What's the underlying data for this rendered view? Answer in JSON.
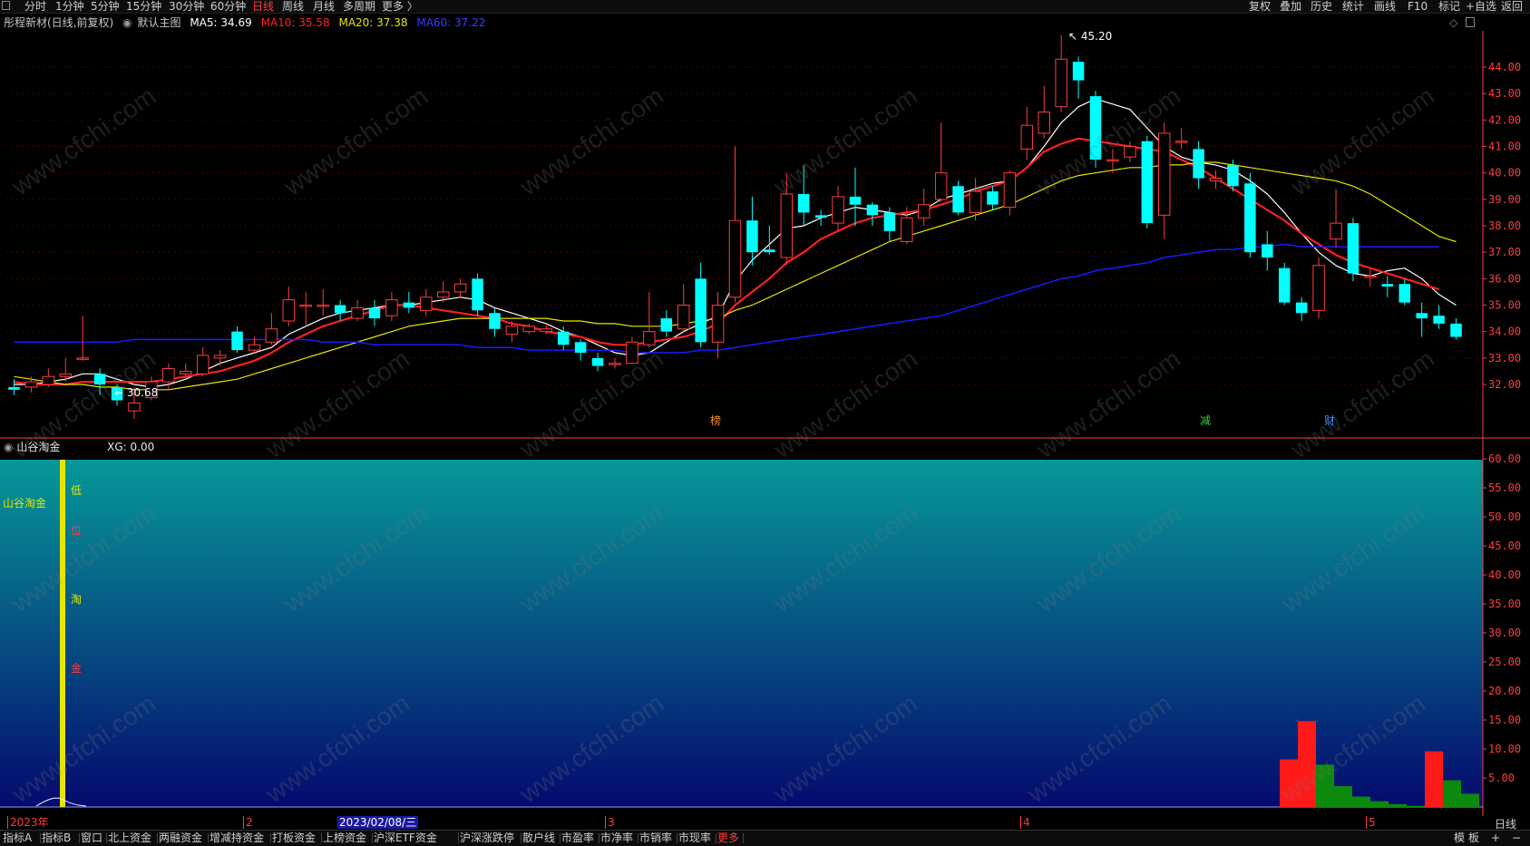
{
  "toolbar": {
    "left_items": [
      "分时",
      "1分钟",
      "5分钟",
      "15分钟",
      "30分钟",
      "60分钟",
      "日线",
      "周线",
      "月线",
      "多周期",
      "更多 〉"
    ],
    "active_item": "日线",
    "right_items": [
      "复权",
      "叠加",
      "历史",
      "统计",
      "画线",
      "F10",
      "标记",
      "+自选",
      "返回"
    ]
  },
  "main_header": {
    "stock_name": "彤程新材(日线,前复权)",
    "indicator_name": "默认主图",
    "ma5": "MA5: 34.69",
    "ma10": "MA10: 35.58",
    "ma20": "MA20: 37.38",
    "ma60": "MA60: 37.22"
  },
  "colors": {
    "ma5": "#ffffff",
    "ma10": "#ff2020",
    "ma20": "#e6e600",
    "ma60": "#1a1aff",
    "up": "#ff3c3c",
    "down": "#00ffff",
    "axis": "#ff3c3c",
    "sub_top": "#069898",
    "sub_bottom": "#050a6e"
  },
  "annotations": {
    "high": "45.20",
    "low": "30.68",
    "events": [
      "榜",
      "减",
      "财"
    ]
  },
  "price_axis": [
    "44.00",
    "43.00",
    "42.00",
    "41.00",
    "40.00",
    "39.00",
    "38.00",
    "37.00",
    "36.00",
    "35.00",
    "34.00",
    "33.00",
    "32.00"
  ],
  "sub_header": {
    "title": "山谷淘金",
    "value": "XG: 0.00"
  },
  "sub_chart": {
    "label": "山谷淘金",
    "vertical_text": [
      "低",
      "位",
      "淘",
      "金"
    ],
    "axis": [
      "60.00",
      "55.00",
      "50.00",
      "45.00",
      "40.00",
      "35.00",
      "30.00",
      "25.00",
      "20.00",
      "15.00",
      "10.00",
      "5.00"
    ],
    "bars": [
      {
        "color": "red",
        "value": 8.2
      },
      {
        "color": "red",
        "value": 14.8
      },
      {
        "color": "green",
        "value": 7.3
      },
      {
        "color": "green",
        "value": 3.6
      },
      {
        "color": "green",
        "value": 1.8
      },
      {
        "color": "green",
        "value": 1.0
      },
      {
        "color": "green",
        "value": 0.5
      },
      {
        "color": "green",
        "value": 0.2
      },
      {
        "color": "red",
        "value": 9.6
      },
      {
        "color": "green",
        "value": 4.6
      },
      {
        "color": "green",
        "value": 2.3
      }
    ]
  },
  "date_axis": {
    "labels": [
      "2023年",
      "2",
      "3",
      "4",
      "5"
    ],
    "cursor_date": "2023/02/08/三"
  },
  "bottom_bar": {
    "items": [
      "指标A",
      "指标B",
      "窗口",
      "北上资金",
      "两融资金",
      "增减持资金",
      "打板资金",
      "上榜资金",
      "沪深ETF资金",
      "沪深涨跌停",
      "散户线",
      "市盈率",
      "市净率",
      "市销率",
      "市现率",
      "更多"
    ],
    "right_items": [
      "模",
      "板",
      "+",
      "−"
    ],
    "period": "日线"
  },
  "watermark": "www.cfchi.com",
  "chart_data": {
    "type": "candlestick",
    "title": "彤程新材(日线,前复权)",
    "ylim": [
      31.0,
      45.5
    ],
    "candles": [
      [
        31.9,
        31.8,
        32.2,
        31.6
      ],
      [
        31.9,
        32.1,
        32.3,
        31.7
      ],
      [
        32.0,
        32.3,
        32.6,
        31.9
      ],
      [
        32.3,
        32.4,
        33.0,
        32.1
      ],
      [
        33.0,
        33.0,
        34.6,
        32.9
      ],
      [
        32.4,
        32.0,
        32.6,
        31.6
      ],
      [
        31.9,
        31.4,
        32.0,
        31.2
      ],
      [
        31.0,
        31.3,
        31.9,
        30.7
      ],
      [
        31.5,
        32.1,
        32.3,
        31.4
      ],
      [
        32.1,
        32.6,
        32.8,
        31.8
      ],
      [
        32.4,
        32.5,
        32.8,
        32.2
      ],
      [
        32.4,
        33.1,
        33.4,
        32.3
      ],
      [
        33.0,
        33.1,
        33.3,
        32.7
      ],
      [
        34.0,
        33.3,
        34.2,
        33.2
      ],
      [
        33.3,
        33.5,
        33.8,
        33.2
      ],
      [
        33.6,
        34.1,
        34.7,
        33.5
      ],
      [
        34.4,
        35.2,
        35.7,
        34.2
      ],
      [
        35.0,
        35.0,
        35.5,
        34.2
      ],
      [
        35.0,
        35.0,
        35.6,
        34.6
      ],
      [
        35.0,
        34.7,
        35.2,
        34.4
      ],
      [
        34.5,
        34.9,
        35.2,
        34.4
      ],
      [
        34.9,
        34.5,
        35.2,
        34.2
      ],
      [
        34.6,
        35.2,
        35.5,
        34.4
      ],
      [
        35.1,
        34.9,
        35.5,
        34.7
      ],
      [
        34.8,
        35.3,
        35.6,
        34.6
      ],
      [
        35.3,
        35.5,
        35.9,
        35.1
      ],
      [
        35.5,
        35.8,
        36.0,
        35.3
      ],
      [
        36.0,
        34.8,
        36.2,
        34.6
      ],
      [
        34.7,
        34.1,
        34.9,
        33.8
      ],
      [
        33.9,
        34.2,
        34.4,
        33.6
      ],
      [
        34.0,
        34.2,
        34.3,
        33.9
      ],
      [
        34.0,
        34.1,
        34.3,
        33.9
      ],
      [
        34.0,
        33.5,
        34.2,
        33.3
      ],
      [
        33.6,
        33.2,
        33.7,
        32.9
      ],
      [
        33.0,
        32.7,
        33.2,
        32.5
      ],
      [
        32.8,
        32.8,
        33.0,
        32.6
      ],
      [
        32.8,
        33.6,
        33.8,
        32.8
      ],
      [
        33.5,
        34.0,
        35.5,
        33.4
      ],
      [
        34.5,
        34.0,
        34.8,
        33.8
      ],
      [
        34.1,
        35.0,
        35.8,
        34.0
      ],
      [
        36.0,
        33.6,
        36.6,
        33.4
      ],
      [
        33.6,
        35.0,
        35.5,
        33.0
      ],
      [
        35.3,
        38.2,
        41.0,
        35.1
      ],
      [
        38.2,
        37.0,
        39.1,
        36.5
      ],
      [
        37.1,
        37.0,
        38.0,
        36.9
      ],
      [
        36.8,
        39.2,
        40.0,
        36.5
      ],
      [
        39.2,
        38.5,
        40.3,
        38.0
      ],
      [
        38.4,
        38.3,
        38.6,
        38.0
      ],
      [
        38.1,
        39.1,
        39.5,
        37.8
      ],
      [
        39.1,
        38.8,
        40.2,
        38.0
      ],
      [
        38.8,
        38.4,
        38.9,
        38.0
      ],
      [
        38.5,
        37.8,
        38.7,
        37.4
      ],
      [
        37.4,
        38.3,
        38.7,
        37.3
      ],
      [
        38.3,
        38.8,
        39.4,
        38.0
      ],
      [
        39.0,
        40.0,
        41.9,
        38.9
      ],
      [
        39.5,
        38.5,
        39.7,
        38.4
      ],
      [
        38.5,
        39.3,
        39.8,
        38.2
      ],
      [
        39.3,
        38.8,
        39.5,
        38.6
      ],
      [
        38.7,
        40.0,
        40.1,
        38.4
      ],
      [
        40.9,
        41.8,
        42.5,
        40.5
      ],
      [
        41.5,
        42.3,
        43.3,
        41.3
      ],
      [
        42.5,
        44.3,
        45.2,
        42.3
      ],
      [
        44.2,
        43.5,
        44.4,
        42.8
      ],
      [
        42.9,
        40.5,
        43.1,
        40.2
      ],
      [
        40.5,
        40.5,
        40.9,
        40.0
      ],
      [
        40.6,
        41.0,
        41.2,
        40.4
      ],
      [
        41.2,
        38.1,
        41.4,
        37.9
      ],
      [
        38.4,
        41.5,
        41.9,
        37.5
      ],
      [
        41.2,
        41.2,
        41.7,
        40.9
      ],
      [
        40.9,
        39.8,
        41.2,
        39.4
      ],
      [
        39.7,
        39.8,
        40.1,
        39.4
      ],
      [
        40.3,
        39.5,
        40.5,
        39.3
      ],
      [
        39.6,
        37.0,
        40.0,
        36.8
      ],
      [
        37.3,
        36.8,
        37.8,
        36.3
      ],
      [
        36.4,
        35.1,
        36.6,
        35.0
      ],
      [
        35.1,
        34.7,
        35.3,
        34.4
      ],
      [
        34.8,
        36.5,
        36.8,
        34.5
      ],
      [
        37.5,
        38.1,
        39.4,
        37.2
      ],
      [
        38.1,
        36.2,
        38.3,
        35.9
      ],
      [
        36.1,
        36.1,
        36.4,
        35.7
      ],
      [
        35.8,
        35.7,
        36.1,
        35.3
      ],
      [
        35.8,
        35.1,
        36.0,
        35.0
      ],
      [
        34.7,
        34.5,
        35.1,
        33.8
      ],
      [
        34.6,
        34.3,
        35.0,
        34.1
      ],
      [
        34.3,
        33.8,
        34.5,
        33.7
      ]
    ],
    "series": [
      {
        "name": "MA5",
        "values": [
          32.0,
          32.0,
          32.1,
          32.2,
          32.4,
          32.4,
          32.2,
          32.0,
          31.9,
          32.0,
          32.2,
          32.5,
          32.8,
          33.0,
          33.2,
          33.4,
          33.9,
          34.2,
          34.5,
          34.7,
          34.8,
          34.9,
          35.0,
          35.0,
          35.1,
          35.2,
          35.3,
          35.2,
          34.9,
          34.7,
          34.5,
          34.3,
          34.0,
          33.8,
          33.5,
          33.2,
          33.1,
          33.2,
          33.6,
          34.0,
          34.3,
          34.6,
          35.9,
          36.7,
          37.3,
          37.9,
          38.0,
          38.3,
          38.5,
          38.7,
          38.6,
          38.5,
          38.4,
          38.6,
          39.0,
          39.2,
          39.4,
          39.6,
          39.7,
          40.2,
          41.0,
          41.9,
          42.5,
          42.8,
          42.6,
          42.4,
          41.7,
          41.0,
          40.6,
          40.4,
          40.3,
          40.1,
          39.7,
          39.2,
          38.5,
          37.7,
          37.0,
          36.5,
          36.2,
          36.1,
          36.3,
          36.4,
          36.0,
          35.4,
          35.0
        ]
      },
      {
        "name": "MA10",
        "values": [
          32.1,
          32.0,
          32.0,
          32.0,
          32.1,
          32.1,
          32.1,
          32.1,
          32.1,
          32.2,
          32.3,
          32.4,
          32.5,
          32.7,
          32.9,
          33.2,
          33.6,
          33.9,
          34.2,
          34.4,
          34.6,
          34.8,
          35.0,
          35.0,
          34.9,
          34.8,
          34.7,
          34.6,
          34.5,
          34.3,
          34.2,
          34.0,
          33.9,
          33.8,
          33.6,
          33.5,
          33.5,
          33.6,
          33.7,
          33.8,
          34.0,
          34.3,
          35.0,
          35.5,
          36.0,
          36.6,
          37.0,
          37.5,
          37.8,
          38.1,
          38.3,
          38.4,
          38.5,
          38.6,
          38.8,
          39.0,
          39.3,
          39.5,
          39.7,
          40.2,
          40.8,
          41.1,
          41.3,
          41.2,
          41.1,
          41.0,
          40.9,
          40.8,
          40.5,
          40.2,
          39.8,
          39.4,
          39.0,
          38.6,
          38.2,
          37.7,
          37.3,
          36.9,
          36.6,
          36.4,
          36.2,
          36.0,
          35.8,
          35.6
        ]
      },
      {
        "name": "MA20",
        "values": [
          32.3,
          32.2,
          32.1,
          32.0,
          32.0,
          31.9,
          31.9,
          31.8,
          31.8,
          31.8,
          31.9,
          32.0,
          32.1,
          32.2,
          32.4,
          32.6,
          32.8,
          33.0,
          33.2,
          33.4,
          33.6,
          33.8,
          34.0,
          34.2,
          34.3,
          34.4,
          34.5,
          34.5,
          34.5,
          34.5,
          34.5,
          34.5,
          34.4,
          34.4,
          34.3,
          34.3,
          34.2,
          34.2,
          34.2,
          34.3,
          34.4,
          34.5,
          34.8,
          35.0,
          35.3,
          35.6,
          35.9,
          36.2,
          36.5,
          36.8,
          37.1,
          37.4,
          37.6,
          37.8,
          38.0,
          38.2,
          38.4,
          38.6,
          38.8,
          39.1,
          39.4,
          39.7,
          39.9,
          40.0,
          40.1,
          40.2,
          40.2,
          40.3,
          40.3,
          40.4,
          40.4,
          40.3,
          40.2,
          40.1,
          40.0,
          39.9,
          39.8,
          39.7,
          39.5,
          39.2,
          38.8,
          38.4,
          38.0,
          37.6,
          37.4
        ]
      },
      {
        "name": "MA60",
        "values": [
          33.6,
          33.6,
          33.6,
          33.6,
          33.6,
          33.6,
          33.6,
          33.7,
          33.7,
          33.7,
          33.7,
          33.7,
          33.7,
          33.7,
          33.7,
          33.7,
          33.7,
          33.7,
          33.6,
          33.6,
          33.6,
          33.5,
          33.5,
          33.5,
          33.5,
          33.5,
          33.5,
          33.4,
          33.4,
          33.4,
          33.3,
          33.3,
          33.3,
          33.3,
          33.3,
          33.3,
          33.2,
          33.2,
          33.2,
          33.2,
          33.3,
          33.3,
          33.4,
          33.5,
          33.6,
          33.7,
          33.8,
          33.9,
          34.0,
          34.1,
          34.2,
          34.3,
          34.4,
          34.5,
          34.6,
          34.8,
          35.0,
          35.2,
          35.4,
          35.6,
          35.8,
          36.0,
          36.1,
          36.3,
          36.4,
          36.5,
          36.6,
          36.8,
          36.9,
          37.0,
          37.1,
          37.1,
          37.2,
          37.2,
          37.3,
          37.2,
          37.2,
          37.2,
          37.2,
          37.2,
          37.2,
          37.2,
          37.2,
          37.2
        ]
      }
    ]
  }
}
